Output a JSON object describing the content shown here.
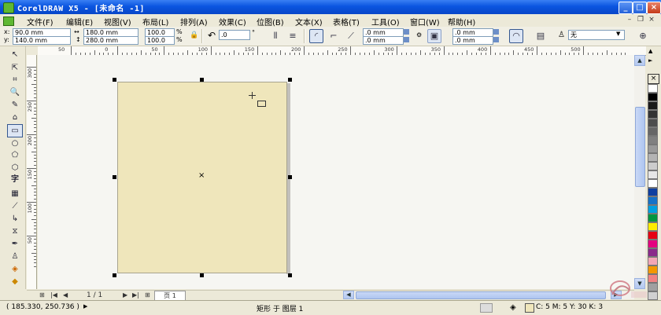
{
  "window": {
    "title": "CorelDRAW X5 - [未命名 -1]"
  },
  "menu": [
    {
      "label": "文件(F)"
    },
    {
      "label": "编辑(E)"
    },
    {
      "label": "视图(V)"
    },
    {
      "label": "布局(L)"
    },
    {
      "label": "排列(A)"
    },
    {
      "label": "效果(C)"
    },
    {
      "label": "位图(B)"
    },
    {
      "label": "文本(X)"
    },
    {
      "label": "表格(T)"
    },
    {
      "label": "工具(O)"
    },
    {
      "label": "窗口(W)"
    },
    {
      "label": "帮助(H)"
    }
  ],
  "property_bar": {
    "x_label": "x:",
    "x_value": "90.0 mm",
    "y_label": "y:",
    "y_value": "140.0 mm",
    "width_value": "180.0 mm",
    "height_value": "280.0 mm",
    "scale_w": "100.0",
    "scale_h": "100.0",
    "percent": "%",
    "rotation_value": ".0",
    "degree": "°",
    "corner1": ".0 mm",
    "corner2": ".0 mm",
    "outline1": ".0 mm",
    "outline2": ".0 mm",
    "outline_width": "无"
  },
  "ruler_top_labels": [
    "50",
    "0",
    "50",
    "100",
    "150",
    "200",
    "250",
    "300",
    "350",
    "400",
    "450",
    "500"
  ],
  "ruler_left_labels": [
    "300",
    "250",
    "200",
    "150",
    "100",
    "50"
  ],
  "page_nav": {
    "page_counter": "1 / 1",
    "page_tab": "页 1"
  },
  "status": {
    "coords": "( 185.330, 250.736 )",
    "object_info": "矩形 于 图层 1",
    "fill_info": "C: 5 M: 5 Y: 30 K: 3"
  },
  "colors": {
    "page_fill": "#efe6bb",
    "palette": [
      "#ffffff",
      "#000000",
      "#1a1a1a",
      "#333333",
      "#4d4d4d",
      "#666666",
      "#808080",
      "#999999",
      "#b3b3b3",
      "#cccccc",
      "#e6e6e6",
      "#ffffff",
      "#0f3fa0",
      "#1672c8",
      "#00a0e0",
      "#009640",
      "#ffed00",
      "#e60012",
      "#e4007f",
      "#8a2a8a",
      "#f3a6b7",
      "#f39800",
      "#f08282",
      "#a0a0a0",
      "#d0d0d0",
      "#c0c0c0"
    ]
  },
  "icons": [
    "coreldraw-app-icon",
    "pick-tool-icon",
    "shape-tool-icon",
    "crop-tool-icon",
    "zoom-tool-icon",
    "freehand-tool-icon",
    "smart-fill-icon",
    "rectangle-tool-icon",
    "ellipse-tool-icon",
    "polygon-tool-icon",
    "basic-shapes-icon",
    "text-tool-icon",
    "table-tool-icon",
    "dimension-tool-icon",
    "connector-tool-icon",
    "blend-tool-icon",
    "eyedropper-icon",
    "outline-pen-icon",
    "fill-tool-icon",
    "interactive-fill-icon"
  ]
}
